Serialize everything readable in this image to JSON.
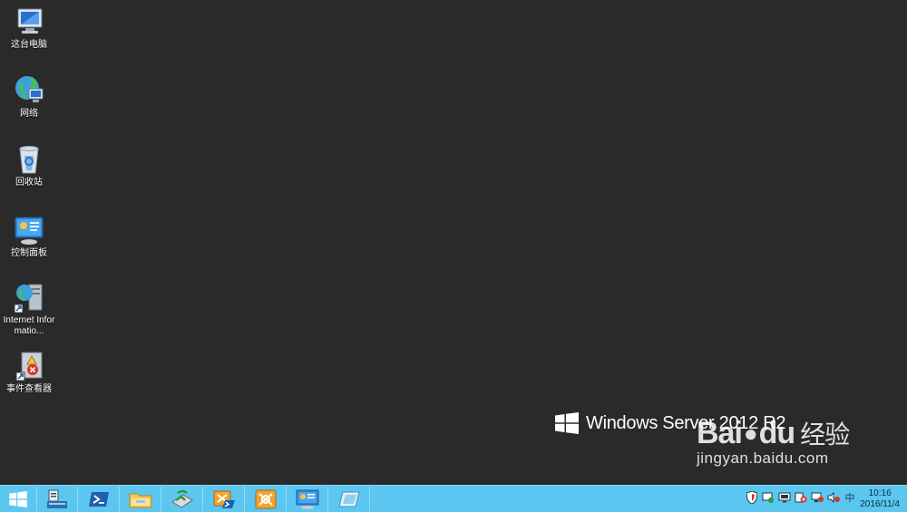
{
  "desktop": {
    "icons": [
      {
        "label": "这台电脑"
      },
      {
        "label": "网络"
      },
      {
        "label": "回收站"
      },
      {
        "label": "控制面板"
      },
      {
        "label": "Internet Informatio..."
      },
      {
        "label": "事件查看器"
      }
    ],
    "brand": "Windows Server 2012 R2",
    "watermark": {
      "logo": "Bai",
      "logo_tail": "du",
      "cn": "经验",
      "url": "jingyan.baidu.com"
    }
  },
  "taskbar": {
    "background": "#5bc7f0",
    "buttons": [
      {
        "icon": "windows-start-icon"
      },
      {
        "icon": "server-manager-icon"
      },
      {
        "icon": "powershell-icon"
      },
      {
        "icon": "file-explorer-icon"
      },
      {
        "icon": "network-tool-icon"
      },
      {
        "icon": "admin-tool-icon"
      },
      {
        "icon": "iis-manager-icon"
      },
      {
        "icon": "control-panel-icon"
      },
      {
        "icon": "app-icon"
      }
    ],
    "tray": {
      "ime": "中",
      "time": "10:16",
      "date": "2016/11/4"
    }
  }
}
